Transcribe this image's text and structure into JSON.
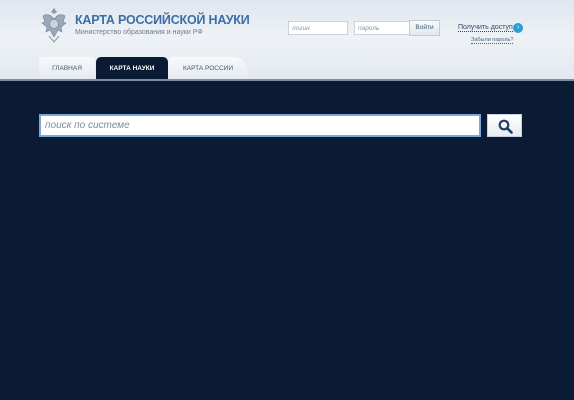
{
  "header": {
    "title": "КАРТА РОССИЙСКОЙ НАУКИ",
    "subtitle": "Министерство образования и науки РФ",
    "login_placeholder": "логин",
    "password_placeholder": "пароль",
    "enter_label": "Войти",
    "access_link": "Получить доступ",
    "access_icon": "›",
    "forgot_link": "Забыли пароль?"
  },
  "tabs": [
    {
      "label": "ГЛАВНАЯ",
      "active": false
    },
    {
      "label": "КАРТА НАУКИ",
      "active": true
    },
    {
      "label": "КАРТА РОССИИ",
      "active": false
    }
  ],
  "search": {
    "placeholder": "поиск по системе",
    "icon": "search-icon"
  },
  "colors": {
    "background": "#0b1b33",
    "accent": "#3b6ea6",
    "access_icon": "#2a9fd6",
    "search_border": "#7aa8d8"
  }
}
